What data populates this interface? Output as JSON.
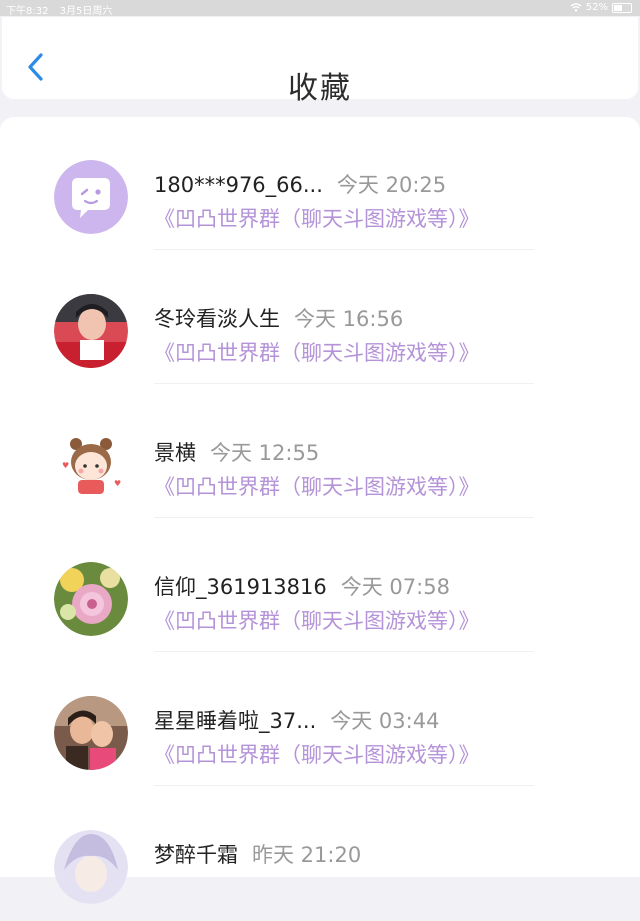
{
  "statusbar": {
    "time": "下午8:32",
    "date": "3月5日周六",
    "battery": "52%",
    "battery_level": 0.52
  },
  "header": {
    "title": "收藏"
  },
  "items": [
    {
      "name": "180***976_66...",
      "time": "今天 20:25",
      "group": "《凹凸世界群（聊天斗图游戏等）》",
      "avatar": "chat-bubble-avatar"
    },
    {
      "name": "冬玲看淡人生",
      "time": "今天 16:56",
      "group": "《凹凸世界群（聊天斗图游戏等）》",
      "avatar": "photo-avatar"
    },
    {
      "name": "景横",
      "time": "今天 12:55",
      "group": "《凹凸世界群（聊天斗图游戏等）》",
      "avatar": "cartoon-girl-avatar"
    },
    {
      "name": "信仰_361913816",
      "time": "今天 07:58",
      "group": "《凹凸世界群（聊天斗图游戏等）》",
      "avatar": "flower-avatar"
    },
    {
      "name": "星星睡着啦_37...",
      "time": "今天 03:44",
      "group": "《凹凸世界群（聊天斗图游戏等）》",
      "avatar": "photo-avatar"
    },
    {
      "name": "梦醉千霜",
      "time": "昨天 21:20",
      "group": "",
      "avatar": "anime-avatar"
    }
  ],
  "colors": {
    "accent": "#2a8ce6",
    "group_text": "#b493d8",
    "time_text": "#999999"
  }
}
